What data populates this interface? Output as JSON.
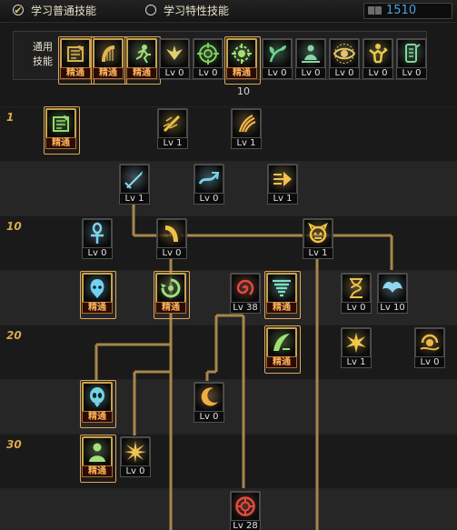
{
  "header": {
    "tab_normal": "学习普通技能",
    "tab_trait": "学习特性技能",
    "radio_check_glyph": "✔",
    "sp_value": "1510"
  },
  "common": {
    "label": "通用技能",
    "page_number": "10",
    "skills": [
      {
        "icon": "book-leaf-icon",
        "color": "#d9b24e",
        "badge": "精通",
        "gold": true,
        "highlight": true
      },
      {
        "icon": "harp-icon",
        "color": "#e2b650",
        "badge": "精通",
        "gold": true,
        "highlight": true
      },
      {
        "icon": "runner-icon",
        "color": "#a3df7c",
        "badge": "精通",
        "gold": true,
        "highlight": true
      },
      {
        "icon": "wings-icon",
        "color": "#e2cf72",
        "badge": "Lv 0",
        "gold": false
      },
      {
        "icon": "target-icon",
        "color": "#7bd15e",
        "badge": "Lv 0",
        "gold": false
      },
      {
        "icon": "target-gear-icon",
        "color": "#9fe06f",
        "badge": "精通",
        "gold": true,
        "highlight": true
      },
      {
        "icon": "plant-figure-icon",
        "color": "#6fd48f",
        "badge": "Lv 0",
        "gold": false
      },
      {
        "icon": "meditate-icon",
        "color": "#86d7a6",
        "badge": "Lv 0",
        "gold": false
      },
      {
        "icon": "eye-icon",
        "color": "#e6c36a",
        "badge": "Lv 0",
        "gold": false
      },
      {
        "icon": "strong-man-icon",
        "color": "#e9c94d",
        "badge": "Lv 0",
        "gold": false
      },
      {
        "icon": "tablet-icon",
        "color": "#7fd79c",
        "badge": "Lv 0",
        "gold": false
      }
    ]
  },
  "tree": {
    "row_labels": [
      "1",
      "",
      "10",
      "",
      "20",
      "",
      "30",
      ""
    ],
    "skills": [
      {
        "name": "book-leaf",
        "icon": "book-leaf-icon",
        "color": "#8fdc6c",
        "badge": "精通",
        "gold": true,
        "highlight": true
      },
      {
        "name": "slash-fire",
        "icon": "slash-icon",
        "color": "#f2c244",
        "badge": "Lv 1",
        "gold": false
      },
      {
        "name": "claw-strike",
        "icon": "claw-icon",
        "color": "#f0b64a",
        "badge": "Lv 1",
        "gold": false
      },
      {
        "name": "sword-dash",
        "icon": "sword-icon",
        "color": "#8bd8ee",
        "badge": "Lv 1",
        "gold": false
      },
      {
        "name": "wave-spear",
        "icon": "wave-icon",
        "color": "#74d1e8",
        "badge": "Lv 0",
        "gold": false
      },
      {
        "name": "dash-strike",
        "icon": "dash-icon",
        "color": "#f5c24e",
        "badge": "Lv 1",
        "gold": false
      },
      {
        "name": "ankh",
        "icon": "ankh-icon",
        "color": "#7fd2ee",
        "badge": "Lv 0",
        "gold": false
      },
      {
        "name": "fang-claw",
        "icon": "fang-icon",
        "color": "#f1c147",
        "badge": "Lv 0",
        "gold": false
      },
      {
        "name": "beast-roar",
        "icon": "beast-icon",
        "color": "#f1c147",
        "badge": "Lv 1",
        "gold": false
      },
      {
        "name": "spirit-head",
        "icon": "spirit-icon",
        "color": "#70d3f2",
        "badge": "精通",
        "gold": true,
        "highlight": true
      },
      {
        "name": "spin-kick",
        "icon": "spin-icon",
        "color": "#9be079",
        "badge": "精通",
        "gold": true,
        "highlight": true
      },
      {
        "name": "crimson-vortex",
        "icon": "vortex-icon",
        "color": "#e34a3a",
        "badge": "Lv 38",
        "gold": false
      },
      {
        "name": "tornado-claw",
        "icon": "tornado-icon",
        "color": "#7fe0c6",
        "badge": "精通",
        "gold": true,
        "highlight": true
      },
      {
        "name": "hourglass",
        "icon": "hourglass-icon",
        "color": "#f0c04a",
        "badge": "Lv 0",
        "gold": false
      },
      {
        "name": "twin-wings",
        "icon": "twin-wings-icon",
        "color": "#8fd6f0",
        "badge": "Lv 10",
        "gold": false
      },
      {
        "name": "green-swoop",
        "icon": "swoop-icon",
        "color": "#9de271",
        "badge": "精通",
        "gold": true,
        "highlight": true
      },
      {
        "name": "gold-burst",
        "icon": "burst-icon",
        "color": "#f4c649",
        "badge": "Lv 1",
        "gold": false
      },
      {
        "name": "sun-wave",
        "icon": "sun-wave-icon",
        "color": "#f1b844",
        "badge": "Lv 0",
        "gold": false
      },
      {
        "name": "alien-head",
        "icon": "alien-icon",
        "color": "#74d5e2",
        "badge": "精通",
        "gold": true,
        "highlight": true
      },
      {
        "name": "crescent-claw",
        "icon": "crescent-icon",
        "color": "#f0ad44",
        "badge": "Lv 0",
        "gold": false
      },
      {
        "name": "green-silhouette",
        "icon": "silhouette-icon",
        "color": "#a5e07c",
        "badge": "精通",
        "gold": true,
        "highlight": true
      },
      {
        "name": "spark-burst",
        "icon": "spark-icon",
        "color": "#f2c553",
        "badge": "Lv 0",
        "gold": false
      },
      {
        "name": "red-rune",
        "icon": "rune-icon",
        "color": "#e54b3a",
        "badge": "Lv 28",
        "gold": false
      }
    ]
  },
  "colors": {
    "line": "#a8864a",
    "row_label": "#d9a94a",
    "sp_value": "#48a4dc"
  }
}
